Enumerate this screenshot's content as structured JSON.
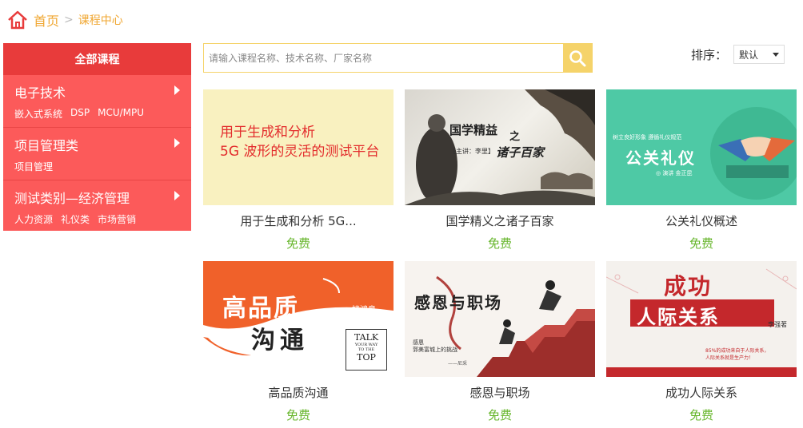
{
  "breadcrumb": {
    "home": "首页",
    "separator": ">",
    "current": "课程中心"
  },
  "sidebar": {
    "header": "全部课程",
    "groups": [
      {
        "title": "电子技术",
        "subs": [
          "嵌入式系统",
          "DSP",
          "MCU/MPU"
        ]
      },
      {
        "title": "项目管理类",
        "subs": [
          "项目管理"
        ]
      },
      {
        "title": "测试类别—经济管理",
        "subs": [
          "人力资源",
          "礼仪类",
          "市场营销"
        ]
      }
    ]
  },
  "search": {
    "placeholder": "请输入课程名称、技术名称、厂家名称",
    "value": ""
  },
  "sort": {
    "label": "排序：",
    "selected": "默认"
  },
  "courses": [
    {
      "title": "用于生成和分析 5G...",
      "price": "免费",
      "thumb": {
        "line1": "用于生成和分析",
        "line2": "5G 波形的灵活的测试平台"
      }
    },
    {
      "title": "国学精义之诸子百家",
      "price": "免费",
      "thumb": {
        "title": "国学精益",
        "sub": "之",
        "name": "诸子百家",
        "lecturer": "【主讲：李里】"
      }
    },
    {
      "title": "公关礼仪概述",
      "price": "免费",
      "thumb": {
        "slogan": "树立良好形象  遵循礼仪规范",
        "title": "公关礼仪",
        "lecturer": "◎ 演讲   金正昆"
      }
    },
    {
      "title": "高品质沟通",
      "price": "免费",
      "thumb": {
        "line1": "高品质",
        "line2": "沟通",
        "author": "褚鸿臬",
        "talk": [
          "TALK",
          "YOUR WAY",
          "TO THE",
          "TOP"
        ]
      }
    },
    {
      "title": "感恩与职场",
      "price": "免费",
      "thumb": {
        "title": "感恩与职场",
        "quote": "感恩\n郭美富城上的挑战",
        "sign": "——尼采"
      }
    },
    {
      "title": "成功人际关系",
      "price": "免费",
      "thumb": {
        "line1": "成功",
        "line2": "人际关系",
        "author": "李强著",
        "note": "85%的成功来自于人际关系，\n人际关系就是生产力！"
      }
    }
  ],
  "colors": {
    "accent": "#f0a732",
    "sidebar": "#fc5a5a",
    "sidebar_head": "#e83b3b",
    "search_border": "#f5d36a",
    "price": "#67b62c"
  }
}
